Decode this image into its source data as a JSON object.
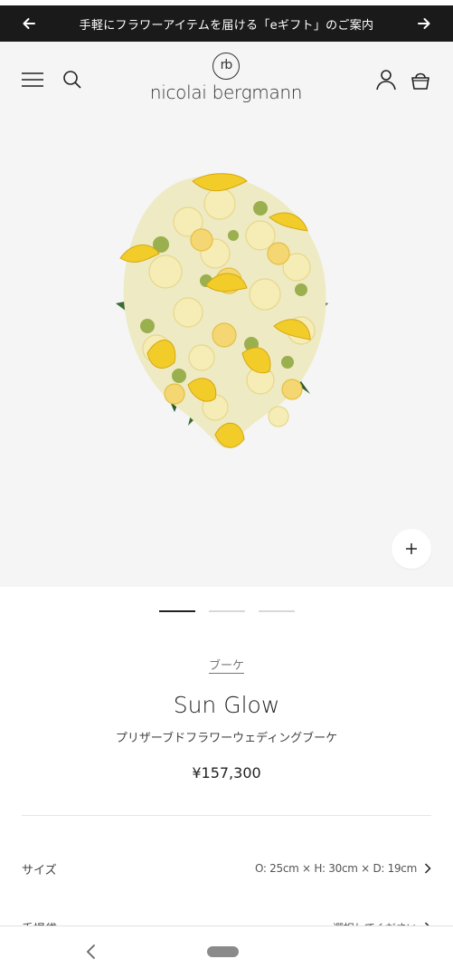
{
  "announcement": {
    "text": "手軽にフラワーアイテムを届ける「eギフト」のご案内",
    "prev_icon": "arrow-left-icon",
    "next_icon": "arrow-right-icon"
  },
  "header": {
    "logo_mark": "rb",
    "logo_text": "nicolai bergmann",
    "icons": [
      "menu-icon",
      "search-icon",
      "account-icon",
      "bag-icon"
    ]
  },
  "gallery": {
    "zoom_label": "+",
    "slide_count": 3,
    "active_slide": 1
  },
  "product": {
    "category": "ブーケ",
    "title": "Sun Glow",
    "subtitle": "プリザーブドフラワーウェディングブーケ",
    "price": "¥157,300"
  },
  "options": [
    {
      "label": "サイズ",
      "value": "O: 25cm × H: 30cm × D: 19cm"
    },
    {
      "label": "手提袋",
      "value": "選択してください"
    }
  ],
  "colors": {
    "announcement_bg": "#1a1a1a",
    "page_bg": "#f5f5f5",
    "flower_yellow": "#f2cd2a"
  }
}
